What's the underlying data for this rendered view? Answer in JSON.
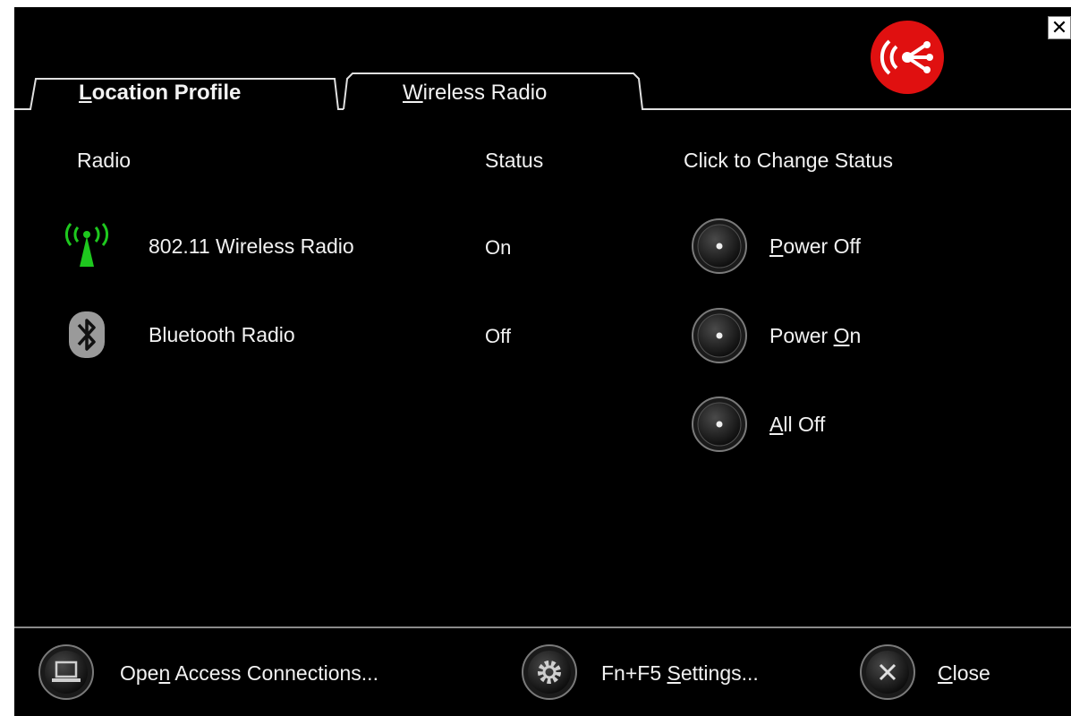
{
  "window": {
    "close_glyph": "✕"
  },
  "tabs": [
    {
      "label_before": "",
      "accel": "L",
      "label_after": "ocation Profile",
      "active": false
    },
    {
      "label_before": "",
      "accel": "W",
      "label_after": "ireless Radio",
      "active": true
    }
  ],
  "columns": {
    "radio": "Radio",
    "status": "Status",
    "action": "Click to Change Status"
  },
  "radios": [
    {
      "name": "802.11 Wireless Radio",
      "status": "On",
      "icon": "wifi-antenna-icon"
    },
    {
      "name": "Bluetooth Radio",
      "status": "Off",
      "icon": "bluetooth-icon"
    }
  ],
  "actions": [
    {
      "before": "",
      "accel": "P",
      "after": "ower Off"
    },
    {
      "before": "Power ",
      "accel": "O",
      "after": "n"
    },
    {
      "before": "",
      "accel": "A",
      "after": "ll Off"
    }
  ],
  "footer": [
    {
      "before": "Ope",
      "accel": "n",
      "after": " Access Connections...",
      "icon": "laptop-icon"
    },
    {
      "before": "Fn+F5 ",
      "accel": "S",
      "after": "ettings...",
      "icon": "gear-icon"
    },
    {
      "before": "",
      "accel": "C",
      "after": "lose",
      "icon": "close-icon"
    }
  ],
  "colors": {
    "accent_red": "#e01010",
    "wifi_green": "#1ec81e",
    "panel_bg": "#000000"
  }
}
